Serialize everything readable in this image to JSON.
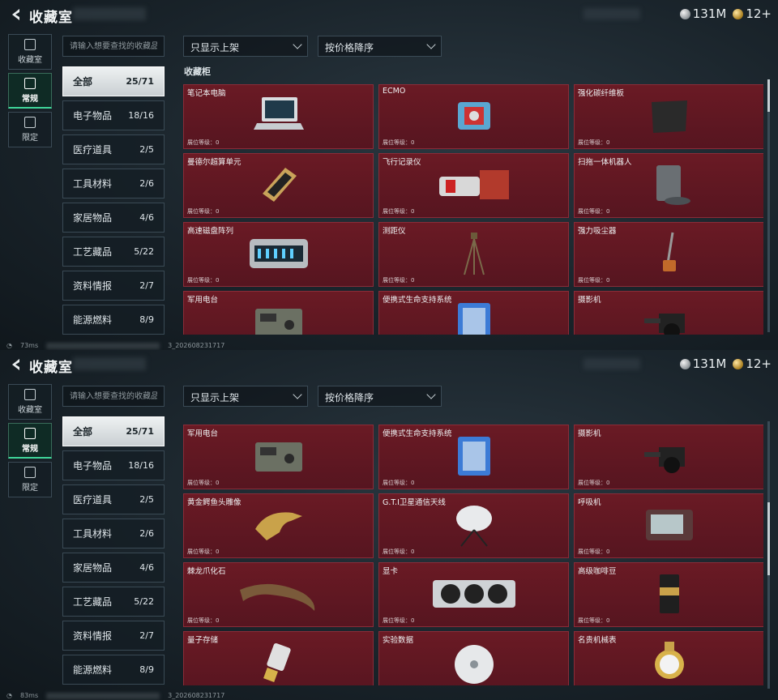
{
  "header": {
    "title": "收藏室",
    "currency_silver": "131M",
    "currency_gold": "12+"
  },
  "sidebar": [
    {
      "label": "收藏室",
      "icon": "trophy-icon",
      "active": false
    },
    {
      "label": "常规",
      "icon": "image-icon",
      "active": true
    },
    {
      "label": "限定",
      "icon": "image-frame-icon",
      "active": false
    }
  ],
  "search": {
    "placeholder": "请输入想要查找的收藏品"
  },
  "filters": {
    "shelf_filter": "只显示上架",
    "sort": "按价格降序"
  },
  "categories": [
    {
      "label": "全部",
      "count": "25/71",
      "active": true
    },
    {
      "label": "电子物品",
      "count": "18/16"
    },
    {
      "label": "医疗道具",
      "count": "2/5"
    },
    {
      "label": "工具材料",
      "count": "2/6"
    },
    {
      "label": "家居物品",
      "count": "4/6"
    },
    {
      "label": "工艺藏品",
      "count": "5/22"
    },
    {
      "label": "资料情报",
      "count": "2/7"
    },
    {
      "label": "能源燃料",
      "count": "8/9"
    }
  ],
  "section_title": "收藏柜",
  "level_label": "展位等级：0",
  "top_items": [
    "笔记本电脑",
    "ECMO",
    "强化碳纤维板",
    "曼德尔超算单元",
    "飞行记录仪",
    "扫拖一体机器人",
    "高速磁盘阵列",
    "测距仪",
    "强力吸尘器",
    "军用电台",
    "便携式生命支持系统",
    "摄影机"
  ],
  "bottom_items": [
    "军用电台",
    "便携式生命支持系统",
    "摄影机",
    "黄金鳄鱼头雕像",
    "G.T.I卫星通信天线",
    "呼吸机",
    "棘龙爪化石",
    "显卡",
    "高级咖啡豆",
    "量子存储",
    "实验数据",
    "名贵机械表"
  ],
  "status": {
    "top_ping": "73ms",
    "top_id": "3_202608231717",
    "bottom_ping": "83ms",
    "bottom_id": "3_202608231717"
  },
  "colors": {
    "card_bg": "#5e1621",
    "accent_green": "#3fd69a",
    "active_cat_bg": "#e6eaec"
  }
}
